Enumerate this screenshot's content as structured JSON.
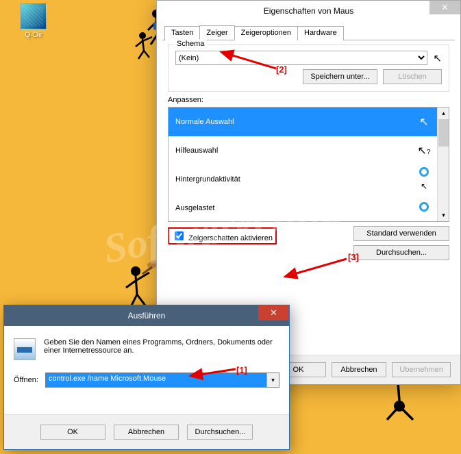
{
  "desktop": {
    "icon_label": "Q-Dir"
  },
  "watermark": "SoftwareOK.de",
  "annotations": {
    "a1": "[1]",
    "a2": "[2]",
    "a3": "[3]"
  },
  "mouseDlg": {
    "title": "Eigenschaften von Maus",
    "tabs": {
      "t0": "Tasten",
      "t1": "Zeiger",
      "t2": "Zeigeroptionen",
      "t3": "Hardware"
    },
    "schema_label": "Schema",
    "schema_value": "(Kein)",
    "save_as": "Speichern unter...",
    "delete": "Löschen",
    "customize_label": "Anpassen:",
    "list": {
      "i0": "Normale Auswahl",
      "i1": "Hilfeauswahl",
      "i2": "Hintergrundaktivität",
      "i3": "Ausgelastet"
    },
    "shadow_label": "Zeigerschatten aktivieren",
    "use_default": "Standard verwenden",
    "browse": "Durchsuchen...",
    "ok": "OK",
    "cancel": "Abbrechen",
    "apply": "Übernehmen"
  },
  "runDlg": {
    "title": "Ausführen",
    "desc": "Geben Sie den Namen eines Programms, Ordners, Dokuments oder einer Internetressource an.",
    "open_label": "Öffnen:",
    "command": "control.exe /name Microsoft.Mouse",
    "ok": "OK",
    "cancel": "Abbrechen",
    "browse": "Durchsuchen..."
  }
}
